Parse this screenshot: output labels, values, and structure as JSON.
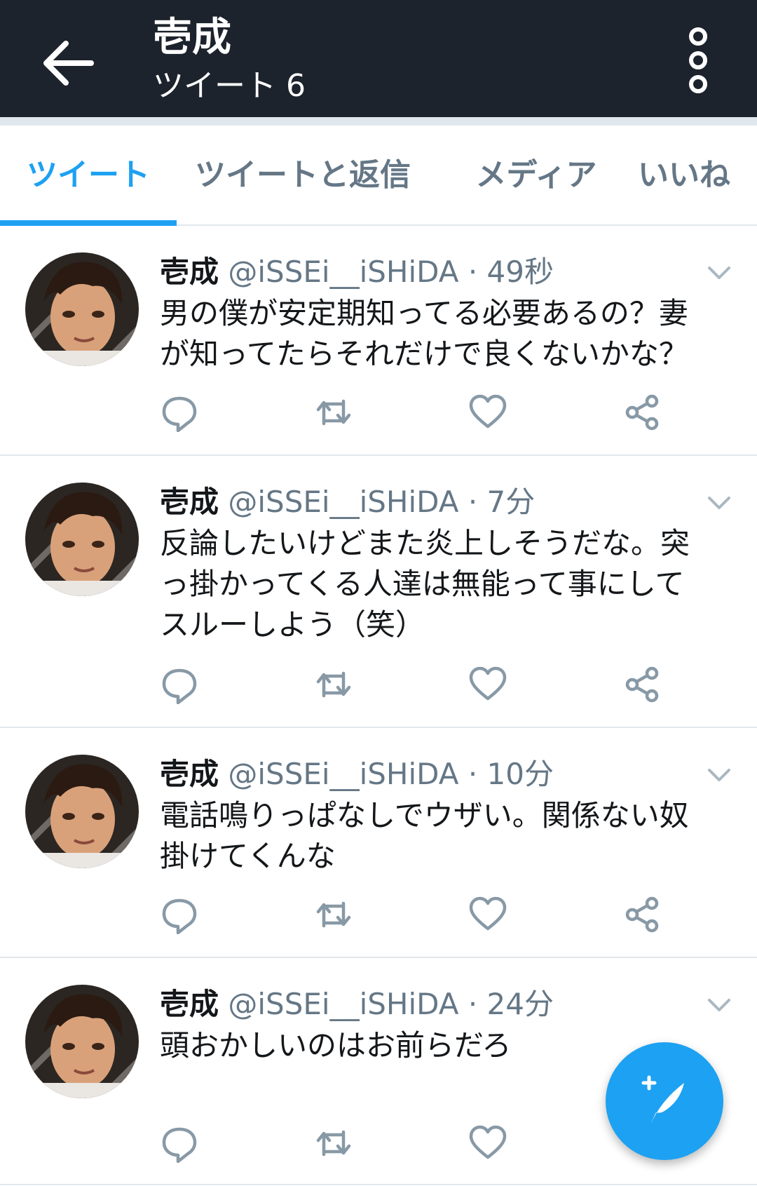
{
  "header": {
    "title": "壱成",
    "subtitle": "ツイート 6"
  },
  "tabs": [
    {
      "label": "ツイート",
      "active": true
    },
    {
      "label": "ツイートと返信",
      "active": false
    },
    {
      "label": "メディア",
      "active": false
    },
    {
      "label": "いいね",
      "active": false
    }
  ],
  "tweets": [
    {
      "name": "壱成",
      "handle": "@iSSEi__iSHiDA",
      "time": "49秒",
      "lines": [
        "男の僕が安定期知ってる必要あるの？妻",
        "が知ってたらそれだけで良くないかな？"
      ]
    },
    {
      "name": "壱成",
      "handle": "@iSSEi__iSHiDA",
      "time": "7分",
      "lines": [
        "反論したいけどまた炎上しそうだな。突",
        "っ掛かってくる人達は無能って事にして",
        "スルーしよう（笑）"
      ]
    },
    {
      "name": "壱成",
      "handle": "@iSSEi__iSHiDA",
      "time": "10分",
      "lines": [
        "電話鳴りっぱなしでウザい。関係ない奴",
        "掛けてくんな"
      ]
    },
    {
      "name": "壱成",
      "handle": "@iSSEi__iSHiDA",
      "time": "24分",
      "lines": [
        "頭おかしいのはお前らだろ"
      ]
    }
  ],
  "icons": {
    "back": "arrow-left-icon",
    "more": "more-vertical-icon",
    "reply": "reply-icon",
    "retweet": "retweet-icon",
    "like": "heart-icon",
    "share": "share-icon",
    "compose": "compose-feather-icon"
  },
  "colors": {
    "appbar": "#1d232c",
    "accent": "#1da1f2",
    "secondary_text": "#657786",
    "divider": "#e1e8ed"
  }
}
